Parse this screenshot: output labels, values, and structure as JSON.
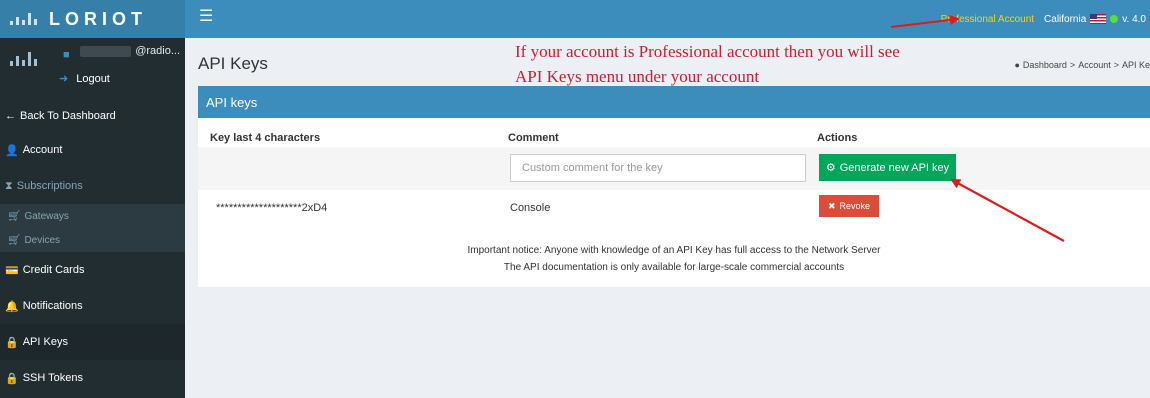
{
  "header": {
    "logo_text": "LORIOT",
    "menu_icon": "hamburger-icon",
    "account_type": "Professional Account",
    "region": "California",
    "version": "v. 4.0"
  },
  "sidebar": {
    "user_email": "@radio...",
    "logout_label": "Logout",
    "items": [
      {
        "icon": "←",
        "label": "Back To Dashboard"
      },
      {
        "icon": "👤",
        "label": "Account"
      },
      {
        "icon": "⧗",
        "label": "Subscriptions"
      },
      {
        "icon": "🛒",
        "label": "Gateways"
      },
      {
        "icon": "🛒",
        "label": "Devices"
      },
      {
        "icon": "💳",
        "label": "Credit Cards"
      },
      {
        "icon": "🔔",
        "label": "Notifications"
      },
      {
        "icon": "🔒",
        "label": "API Keys"
      },
      {
        "icon": "🔒",
        "label": "SSH Tokens"
      }
    ]
  },
  "page": {
    "title": "API Keys",
    "annotation_line1": "If your account is Professional account then you will see",
    "annotation_line2": "API Keys menu under your account",
    "breadcrumb": {
      "root": "Dashboard",
      "sep": ">",
      "level1": "Account",
      "level2": "API Ke"
    }
  },
  "panel": {
    "title": "API keys",
    "columns": [
      "Key last 4 characters",
      "Comment",
      "Actions"
    ],
    "comment_placeholder": "Custom comment for the key",
    "generate_label": "Generate new API key",
    "keys": [
      {
        "key": "********************2xD4",
        "comment": "Console",
        "action": "Revoke"
      }
    ],
    "notice_line1": "Important notice: Anyone with knowledge of an API Key has full access to the Network Server",
    "notice_line2": "The API documentation is only available for large-scale commercial accounts"
  },
  "colors": {
    "header_blue": "#3c8dbc",
    "sidebar_dark": "#222d32",
    "generate_green": "#00a65a",
    "revoke_red": "#dd4b39",
    "annotation_red": "#c8202e",
    "pro_account_yellow": "#f3d21a"
  }
}
